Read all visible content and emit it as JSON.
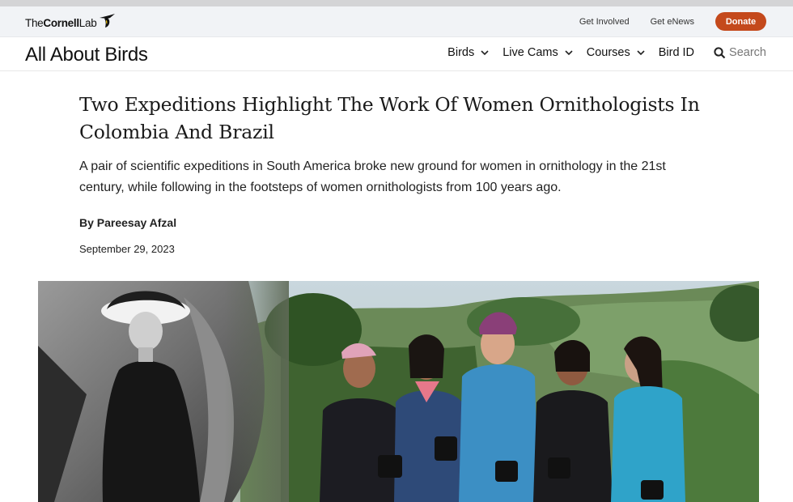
{
  "utility": {
    "logo": {
      "the": "The",
      "cornell": "Cornell",
      "lab": "Lab"
    },
    "links": [
      "Get Involved",
      "Get eNews"
    ],
    "donate_label": "Donate"
  },
  "nav": {
    "site_title": "All About Birds",
    "items": [
      {
        "label": "Birds",
        "has_menu": true
      },
      {
        "label": "Live Cams",
        "has_menu": true
      },
      {
        "label": "Courses",
        "has_menu": true
      },
      {
        "label": "Bird ID",
        "has_menu": false
      }
    ],
    "search_label": "Search"
  },
  "article": {
    "headline_line1": "Two Expeditions Highlight The Work Of Women Ornithologists In",
    "headline_line2": "Colombia And Brazil",
    "dek_line1": "A pair of scientific expeditions in South America broke new ground for women in ornithology in the 21st",
    "dek_line2": "century, while following in the footsteps of women ornithologists from 100 years ago.",
    "byline": "By Pareesay Afzal",
    "date": "September 29, 2023"
  },
  "colors": {
    "donate": "#c4491c",
    "utility_bg": "#f1f3f6"
  }
}
